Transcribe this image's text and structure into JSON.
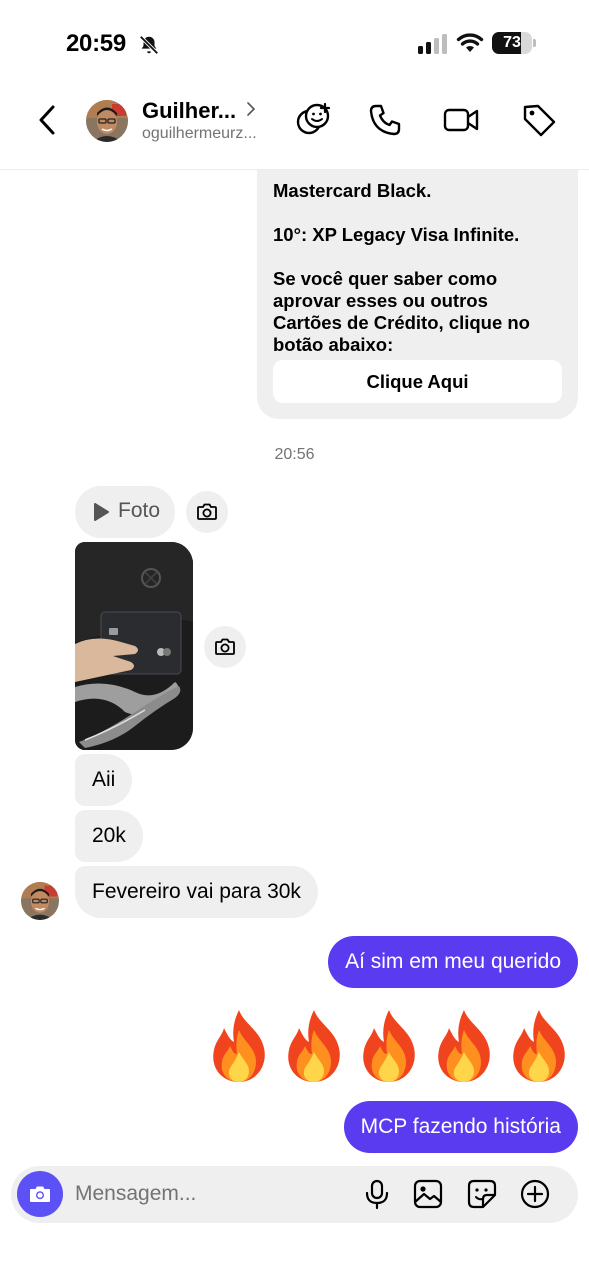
{
  "status_bar": {
    "time": "20:59",
    "battery_percent": "73",
    "battery_level": 0.73,
    "icons": [
      "bell-off-icon",
      "cellular-signal-icon",
      "wifi-icon",
      "battery-icon"
    ]
  },
  "header": {
    "name": "Guilher...",
    "username": "oguilhermeurz...",
    "actions": [
      "add-friend-emoji-icon",
      "phone-icon",
      "video-icon",
      "tag-icon"
    ]
  },
  "messages": {
    "bot": {
      "line1": "Mastercard Black.",
      "line2": "10°: XP Legacy Visa Infinite.",
      "line3": "Se você quer saber como",
      "line4": "aprovar esses ou outros",
      "line5": "Cartões de Crédito, clique no",
      "line6": "botão abaixo:",
      "button": "Clique Aqui"
    },
    "timestamp": "20:56",
    "photo_label": "Foto",
    "incoming": [
      "Aii",
      "20k",
      "Fevereiro vai para 30k"
    ],
    "outgoing_1": "Aí sim em meu querido",
    "emoji_reaction": "🔥🔥🔥🔥🔥",
    "outgoing_2": "MCP fazendo história"
  },
  "composer": {
    "placeholder": "Mensagem...",
    "icons": [
      "camera-icon",
      "microphone-icon",
      "gallery-icon",
      "sticker-icon",
      "plus-icon"
    ]
  },
  "colors": {
    "outgoing_bubble": "#5b3bf0",
    "incoming_bubble": "#efefef",
    "camera_button": "#5b51f4"
  }
}
